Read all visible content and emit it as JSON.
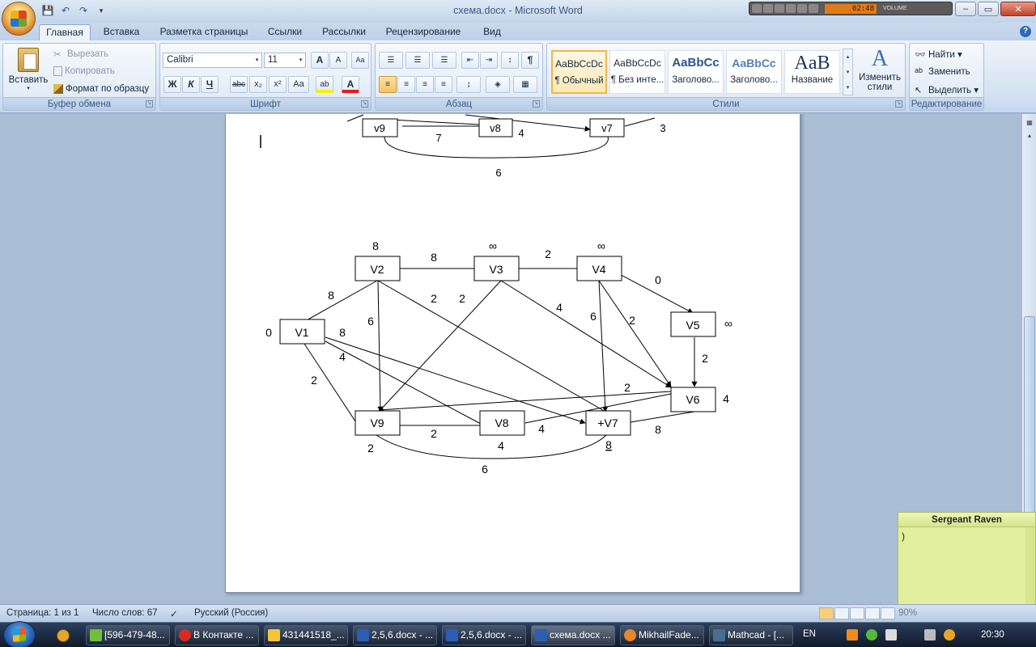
{
  "window": {
    "title": "схема.docx - Microsoft Word",
    "media_time": "02:48",
    "media_volume_label": "VOLUME",
    "controls": {
      "minimize": "–",
      "maximize": "▭",
      "close": "✕"
    }
  },
  "quick_access": {
    "save": "💾",
    "undo": "↶",
    "redo": "↷",
    "customize": "▾"
  },
  "tabs": [
    "Главная",
    "Вставка",
    "Разметка страницы",
    "Ссылки",
    "Рассылки",
    "Рецензирование",
    "Вид"
  ],
  "help": "?",
  "ribbon": {
    "clipboard": {
      "label": "Буфер обмена",
      "paste": "Вставить",
      "cut": "Вырезать",
      "copy": "Копировать",
      "format_painter": "Формат по образцу"
    },
    "font": {
      "label": "Шрифт",
      "font_name": "Calibri",
      "font_size": "11",
      "grow": "A",
      "shrink": "A",
      "clear": "Aa",
      "bold": "Ж",
      "italic": "К",
      "underline": "Ч",
      "strike": "abc",
      "subscript": "x₂",
      "superscript": "x²",
      "case": "Aa",
      "highlight": "ab",
      "font_color": "A"
    },
    "paragraph": {
      "label": "Абзац",
      "show_marks": "¶"
    },
    "styles": {
      "label": "Стили",
      "items": [
        {
          "sample": "AaBbCcDc",
          "name": "¶ Обычный",
          "selected": true
        },
        {
          "sample": "AaBbCcDc",
          "name": "¶ Без инте...",
          "selected": false
        },
        {
          "sample": "AaBbCc",
          "name": "Заголово...",
          "selected": false
        },
        {
          "sample": "AaBbCc",
          "name": "Заголово...",
          "selected": false
        },
        {
          "sample": "AaB",
          "name": "Название",
          "selected": false
        }
      ],
      "change_styles_line1": "Изменить",
      "change_styles_line2": "стили"
    },
    "editing": {
      "label": "Редактирование",
      "find": "Найти",
      "replace": "Заменить",
      "select": "Выделить"
    }
  },
  "graph_top": {
    "nodes": [
      {
        "id": "v9",
        "label": "v9"
      },
      {
        "id": "v8",
        "label": "v8"
      },
      {
        "id": "v7",
        "label": "v7"
      }
    ],
    "labels": [
      "7",
      "4",
      "3",
      "6"
    ]
  },
  "graph_main": {
    "nodes": [
      {
        "id": "V1",
        "label": "V1",
        "weight": "0"
      },
      {
        "id": "V2",
        "label": "V2",
        "weight": "8"
      },
      {
        "id": "V3",
        "label": "V3",
        "weight": "∞"
      },
      {
        "id": "V4",
        "label": "V4",
        "weight": "∞"
      },
      {
        "id": "V5",
        "label": "V5",
        "weight": "∞"
      },
      {
        "id": "V6",
        "label": "V6",
        "weight": "4"
      },
      {
        "id": "V7",
        "label": "+V7",
        "weight": "8"
      },
      {
        "id": "V8",
        "label": "V8",
        "weight": "4"
      },
      {
        "id": "V9",
        "label": "V9",
        "weight": "2"
      }
    ],
    "edge_labels": [
      "8",
      "2",
      "0",
      "8",
      "6",
      "2",
      "2",
      "4",
      "6",
      "2",
      "8",
      "4",
      "2",
      "2",
      "2",
      "2",
      "4",
      "8",
      "6"
    ]
  },
  "sticky_note": {
    "title": "Sergeant Raven",
    "text": ")"
  },
  "status": {
    "page": "Страница: 1 из 1",
    "words": "Число слов: 67",
    "language": "Русский (Россия)",
    "zoom": "90%"
  },
  "taskbar": {
    "items": [
      {
        "label": "[596-479-48...",
        "color": "#6fbf3b",
        "active": false
      },
      {
        "label": "В Контакте ...",
        "color": "#d62b1f",
        "active": false
      },
      {
        "label": "431441518_...",
        "color": "#f2c438",
        "active": false
      },
      {
        "label": "2,5,6.docx - ...",
        "color": "#2b5fb3",
        "active": false
      },
      {
        "label": "2,5,6.docx - ...",
        "color": "#2b5fb3",
        "active": false
      },
      {
        "label": "схема.docx ...",
        "color": "#2b5fb3",
        "active": true
      },
      {
        "label": "MikhailFade...",
        "color": "#e8862b",
        "active": false
      },
      {
        "label": "Mathcad - [...",
        "color": "#4a6e8f",
        "active": false
      }
    ],
    "lang": "EN",
    "clock": "20:30"
  }
}
